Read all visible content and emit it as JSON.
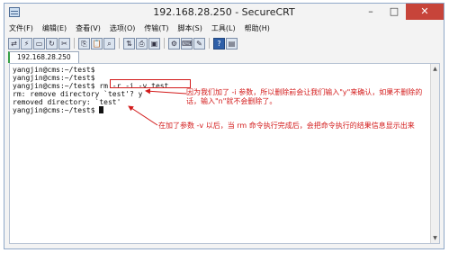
{
  "window": {
    "title": "192.168.28.250 - SecureCRT"
  },
  "window_controls": {
    "minimize": "–",
    "maximize": "□",
    "close": "✕"
  },
  "menu": [
    "文件(F)",
    "编辑(E)",
    "查看(V)",
    "选项(O)",
    "传输(T)",
    "脚本(S)",
    "工具(L)",
    "帮助(H)"
  ],
  "tab": {
    "label": "192.168.28.250"
  },
  "terminal": {
    "lines": [
      "yangjin@cms:~/test$",
      "yangjin@cms:~/test$",
      "yangjin@cms:~/test$ rm -r -i -v test",
      "rm: remove directory `test'? y",
      "removed directory: `test'",
      "yangjin@cms:~/test$ "
    ]
  },
  "annotations": {
    "note1": "因为我们加了 -i 参数，所以删除前会让我们输入\"y\"来确认，如果不删除的话，输入\"n\"就不会删除了。",
    "note2": "在加了参数 -v 以后，当 rm 命令执行完成后，会把命令执行的结果信息显示出来"
  },
  "colors": {
    "annotation": "#d31b1b",
    "close_button": "#c7443a",
    "tab_marker": "#36a146"
  }
}
